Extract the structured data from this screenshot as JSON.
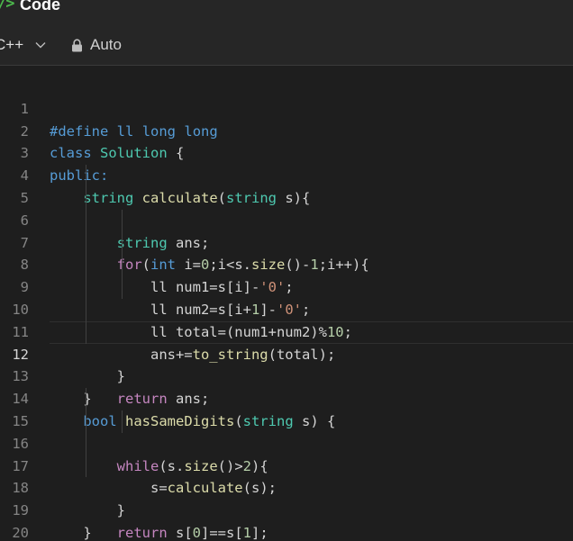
{
  "header": {
    "icon_glyph": "/>",
    "title": "Code"
  },
  "toolbar": {
    "language": "C++",
    "autosave_label": "Auto",
    "icons": [
      "chevron-down-icon",
      "lock-icon"
    ]
  },
  "editor": {
    "current_line": 12,
    "line_numbers": [
      "1",
      "2",
      "3",
      "4",
      "5",
      "6",
      "7",
      "8",
      "9",
      "10",
      "11",
      "12",
      "13",
      "14",
      "15",
      "16",
      "17",
      "18",
      "19",
      "20"
    ],
    "lines": [
      "#define ll long long",
      "class Solution {",
      "public:",
      "    string calculate(string s){",
      "        string ans;",
      "        for(int i=0;i<s.size()-1;i++){",
      "            ll num1=s[i]-'0';",
      "            ll num2=s[i+1]-'0';",
      "            ll total=(num1+num2)%10;",
      "            ans+=to_string(total);",
      "        }",
      "        return ans;",
      "    }",
      "    bool hasSameDigits(string s) {",
      "        while(s.size()>2){",
      "            s=calculate(s);",
      "        }",
      "        return s[0]==s[1];",
      "    }",
      "};"
    ]
  },
  "colors": {
    "background": "#1e1e1e",
    "header_bg": "#262626",
    "keyword": "#569cd6",
    "type": "#4ec9b0",
    "function": "#dcdcaa",
    "control": "#c586c0",
    "number": "#b5cea8",
    "string": "#ce9178",
    "brand_green": "#4cb74c"
  }
}
